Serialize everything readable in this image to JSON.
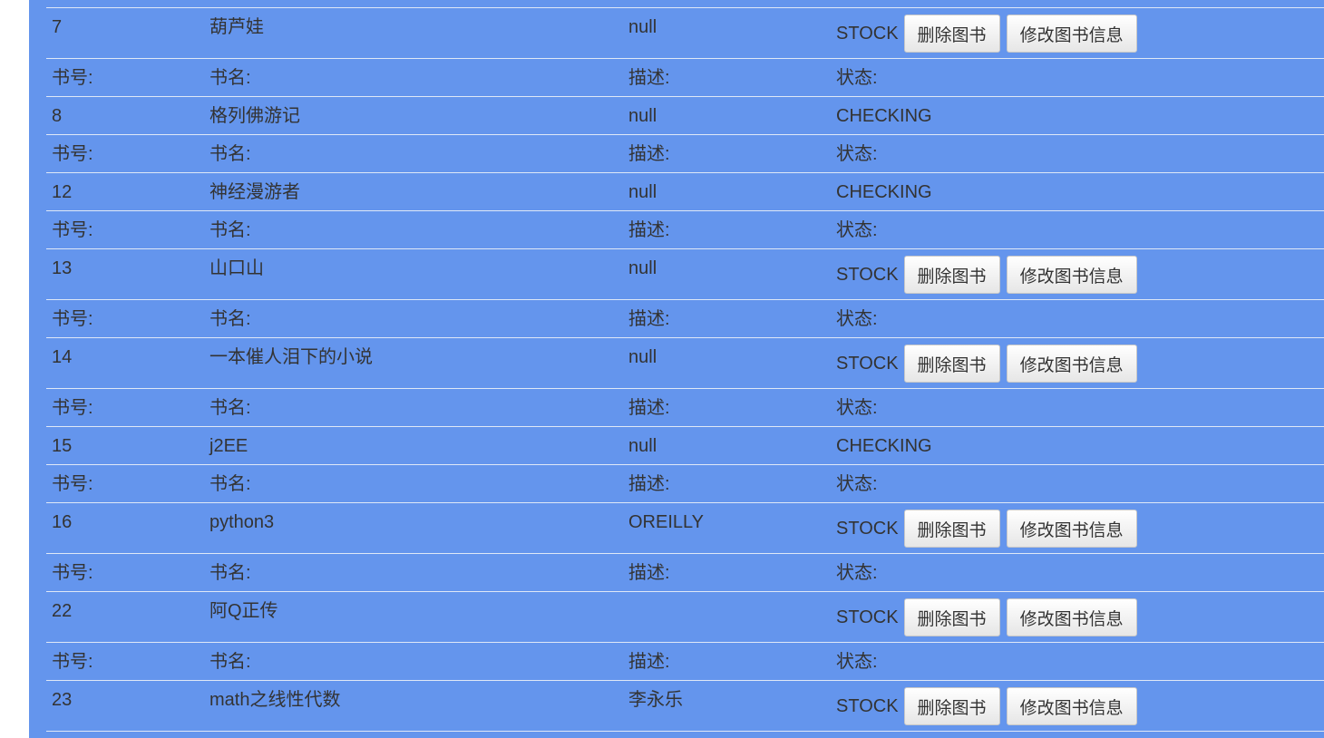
{
  "header_labels": {
    "id": "书号:",
    "name": "书名:",
    "desc": "描述:",
    "status": "状态:"
  },
  "buttons": {
    "delete": "删除图书",
    "edit": "修改图书信息"
  },
  "books": [
    {
      "id": "7",
      "name": "葫芦娃",
      "desc": "null",
      "status": "STOCK",
      "actions": true
    },
    {
      "id": "8",
      "name": "格列佛游记",
      "desc": "null",
      "status": "CHECKING",
      "actions": false
    },
    {
      "id": "12",
      "name": "神经漫游者",
      "desc": "null",
      "status": "CHECKING",
      "actions": false
    },
    {
      "id": "13",
      "name": "山口山",
      "desc": "null",
      "status": "STOCK",
      "actions": true
    },
    {
      "id": "14",
      "name": "一本催人泪下的小说",
      "desc": "null",
      "status": "STOCK",
      "actions": true
    },
    {
      "id": "15",
      "name": "j2EE",
      "desc": "null",
      "status": "CHECKING",
      "actions": false
    },
    {
      "id": "16",
      "name": "python3",
      "desc": "OREILLY",
      "status": "STOCK",
      "actions": true
    },
    {
      "id": "22",
      "name": "阿Q正传",
      "desc": "",
      "status": "STOCK",
      "actions": true
    },
    {
      "id": "23",
      "name": "math之线性代数",
      "desc": "李永乐",
      "status": "STOCK",
      "actions": true
    }
  ],
  "colors": {
    "panel": "#6495ED"
  }
}
